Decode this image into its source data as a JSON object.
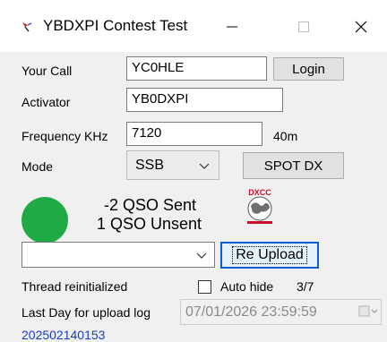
{
  "window": {
    "title": "YBDXPI Contest Test",
    "minimize_glyph": "—",
    "close_glyph": "✕"
  },
  "form": {
    "your_call_label": "Your Call",
    "your_call_value": "YC0HLE",
    "login_label": "Login",
    "activator_label": "Activator",
    "activator_value": "YB0DXPI",
    "frequency_label": "Frequency KHz",
    "frequency_value": "7120",
    "band_label": "40m",
    "mode_label": "Mode",
    "mode_value": "SSB",
    "spot_label": "SPOT DX"
  },
  "status": {
    "indicator_color": "#1faa45",
    "qso_sent": "-2 QSO Sent",
    "qso_unsent": "1 QSO Unsent",
    "dxcc_logo_text": "DXCC"
  },
  "upload": {
    "select_value": "",
    "reupload_label": "Re Upload",
    "thread_status": "Thread reinitialized",
    "autohide_label": "Auto hide",
    "autohide_checked": false,
    "page_counter": "3/7",
    "last_day_label": "Last Day for upload  log",
    "last_day_value": "07/01/2026 23:59:59"
  },
  "footer": {
    "version": "202502140153"
  },
  "colors": {
    "accent_focus": "#0b5fd3",
    "link_blue": "#1a3cc4"
  }
}
